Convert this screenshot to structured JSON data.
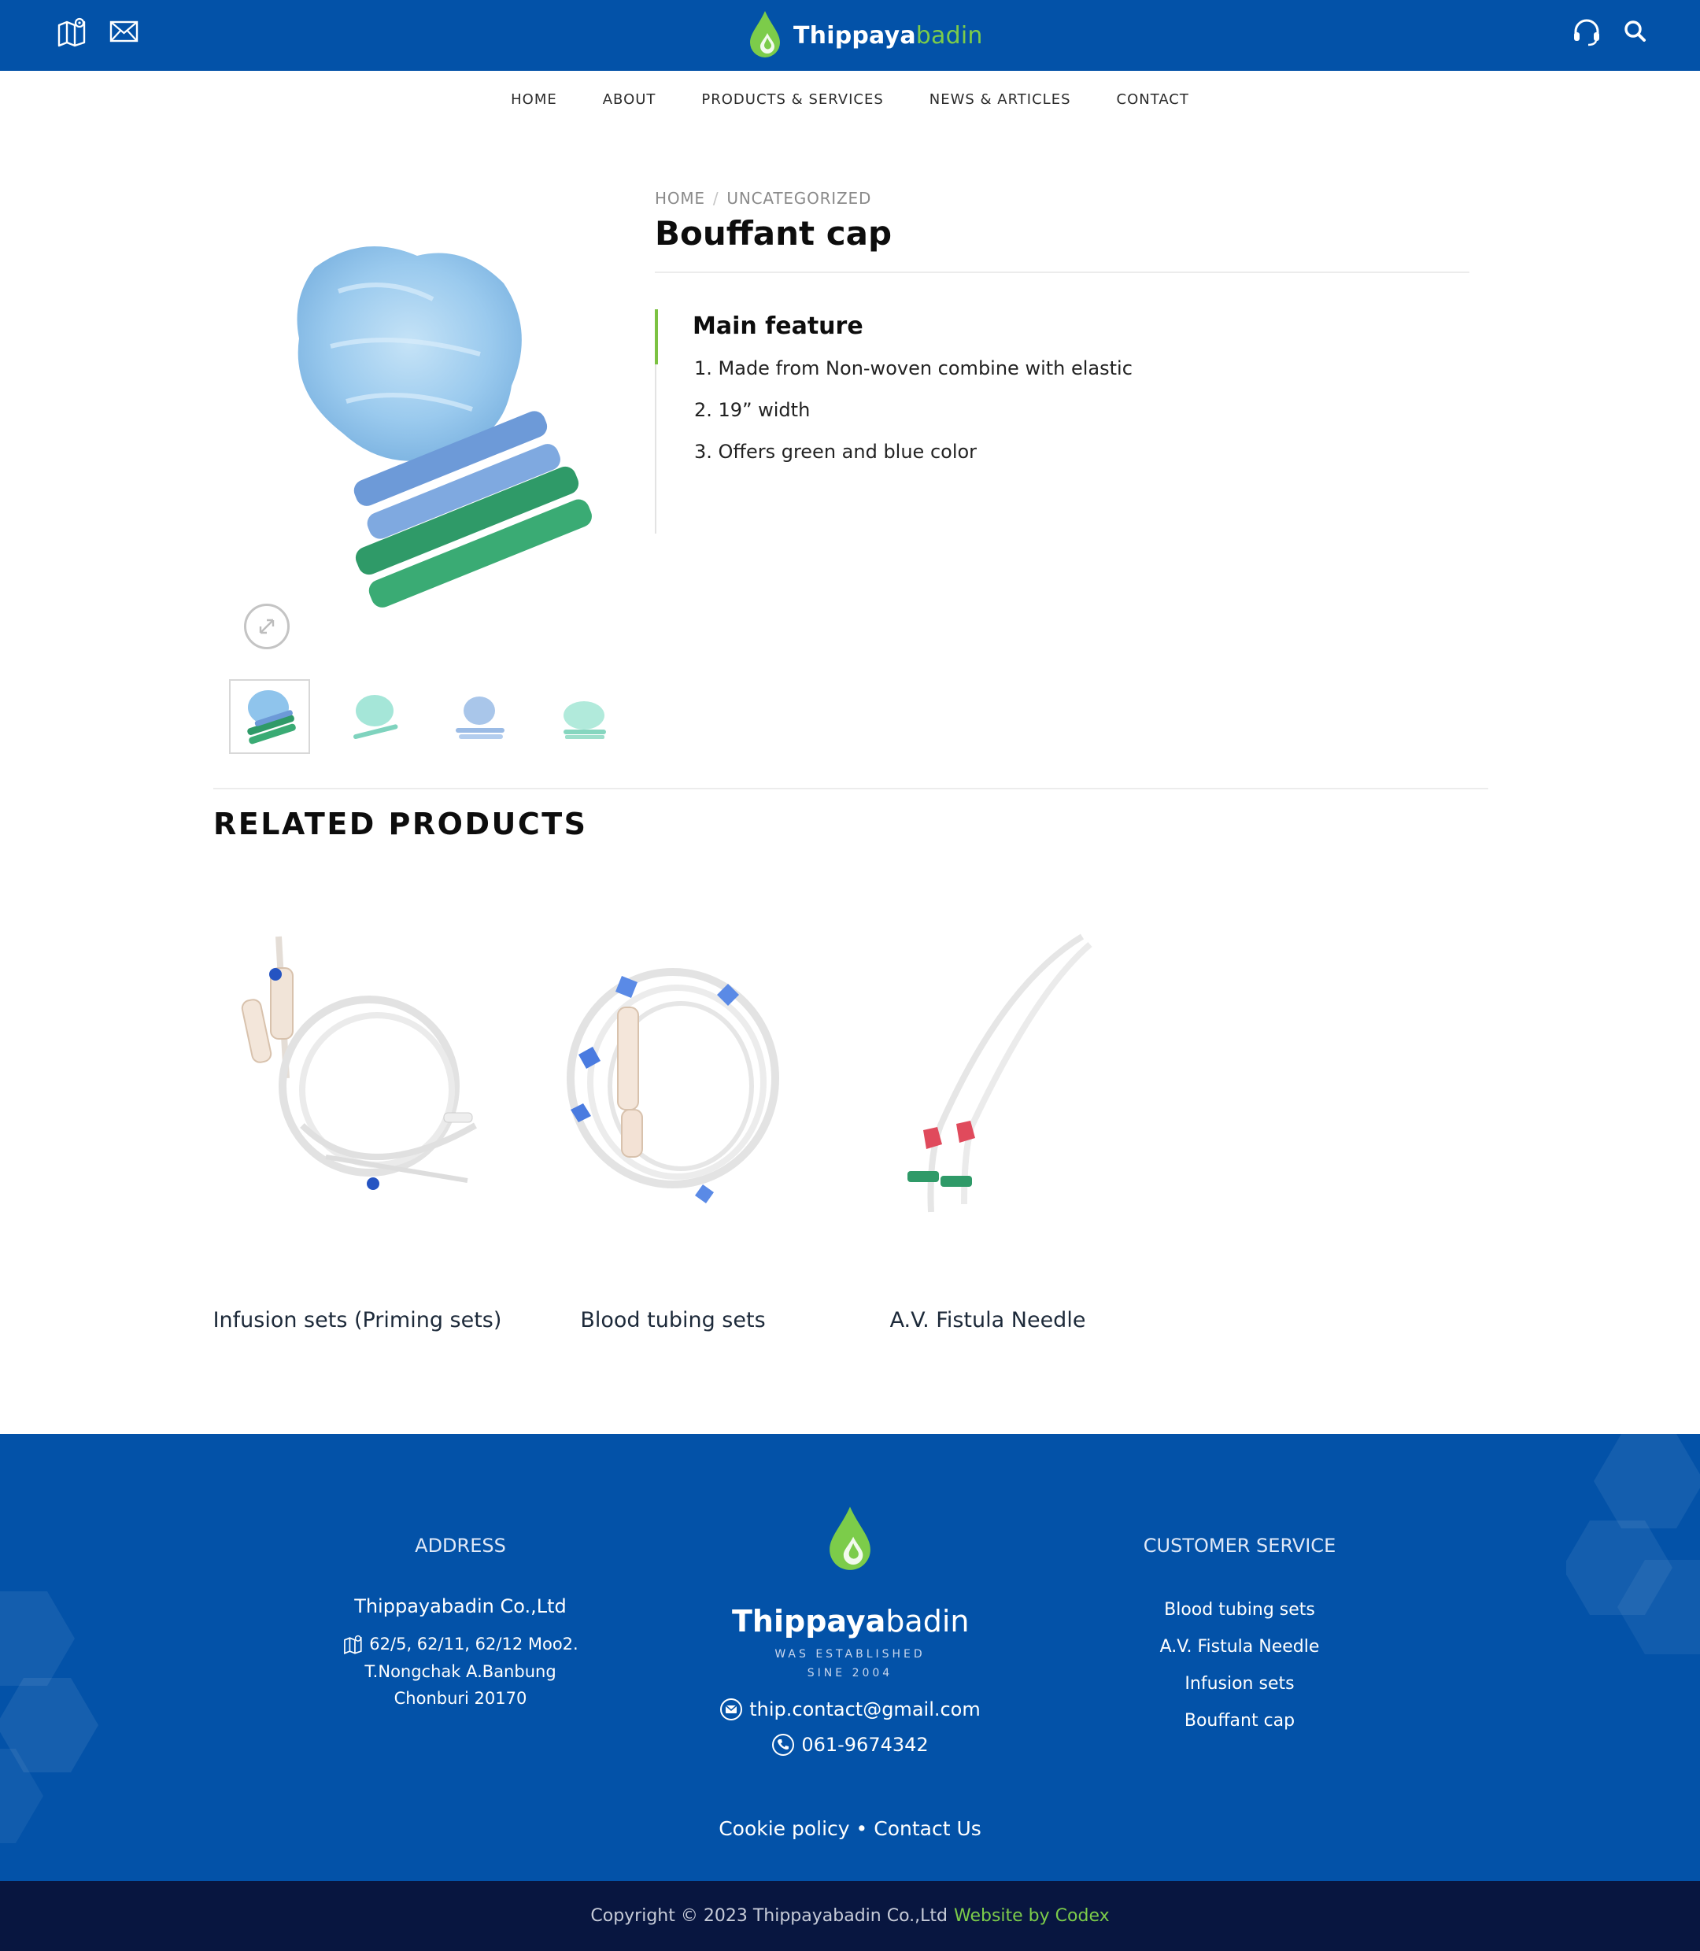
{
  "header": {
    "brand_main": "Thippaya",
    "brand_accent": "badin",
    "icons": [
      "map-pin-icon",
      "mail-icon",
      "headset-icon",
      "search-icon"
    ]
  },
  "nav": {
    "items": [
      "HOME",
      "ABOUT",
      "PRODUCTS & SERVICES",
      "NEWS & ARTICLES",
      "CONTACT"
    ]
  },
  "breadcrumb": {
    "home": "HOME",
    "separator": "/",
    "category": "UNCATEGORIZED"
  },
  "product": {
    "title": "Bouffant cap",
    "feature_heading": "Main feature",
    "features": [
      "1. Made from Non-woven combine with elastic",
      "2. 19” width",
      "3. Offers green and blue color"
    ]
  },
  "related": {
    "heading": "RELATED PRODUCTS",
    "items": [
      {
        "name": "Infusion sets (Priming sets)"
      },
      {
        "name": "Blood tubing sets"
      },
      {
        "name": "A.V. Fistula Needle"
      }
    ]
  },
  "footer": {
    "address_title": "ADDRESS",
    "company": "Thippayabadin Co.,Ltd",
    "address_lines": [
      "62/5, 62/11, 62/12 Moo2.",
      "T.Nongchak A.Banbung",
      "Chonburi 20170"
    ],
    "brand_main": "Thippaya",
    "brand_accent": "badin",
    "established_line1": "WAS ESTABLISHED",
    "established_line2": "SINE 2004",
    "email": "thip.contact@gmail.com",
    "phone": "061-9674342",
    "cookie_policy": "Cookie policy",
    "link_separator": "•",
    "contact_us": "Contact Us",
    "cs_title": "CUSTOMER SERVICE",
    "cs_items": [
      "Blood tubing sets",
      "A.V. Fistula Needle",
      "Infusion sets",
      "Bouffant cap"
    ]
  },
  "copyright": {
    "text": "Copyright © 2023 Thippayabadin Co.,Ltd",
    "credit": "Website by Codex"
  },
  "colors": {
    "header_blue": "#0352a8",
    "accent_green": "#7ccc4a",
    "footer_dark": "#081640"
  }
}
